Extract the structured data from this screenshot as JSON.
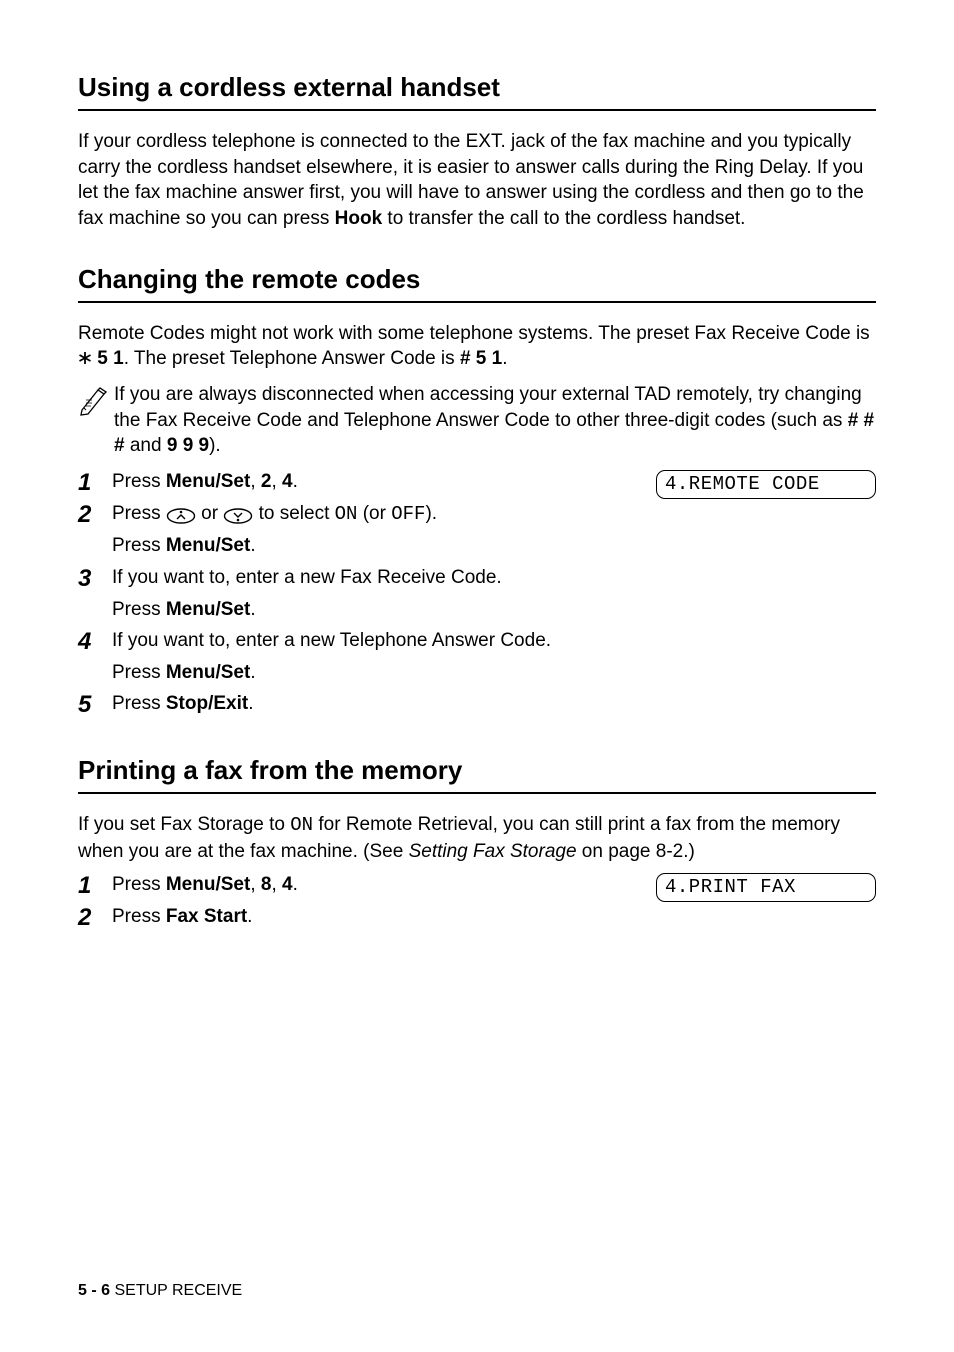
{
  "sections": {
    "sec1": {
      "heading": "Using a cordless external handset",
      "para_parts": {
        "a": "If your cordless telephone is connected to the EXT. jack of the fax machine and you typically carry the cordless handset elsewhere, it is easier to answer calls during the Ring Delay. If you let the fax machine answer first, you will have to answer using the cordless and then go to the fax machine so you can press ",
        "hook": "Hook",
        "b": " to transfer the call to the cordless handset."
      }
    },
    "sec2": {
      "heading": "Changing the remote codes",
      "para_parts": {
        "a": "Remote Codes might not work with some telephone systems. The preset Fax Receive Code is ",
        "code1": " 5 1",
        "b": ". The preset Telephone Answer Code is ",
        "code2": "# 5 1",
        "c": "."
      },
      "note": {
        "a": "If you are always disconnected when accessing your external TAD remotely, try changing the Fax Receive Code and Telephone Answer Code to other three-digit codes (such as ",
        "code1": "# # #",
        "b": " and ",
        "code2": "9 9 9",
        "c": ")."
      },
      "steps": {
        "s1": {
          "press": "Press ",
          "menuset": "Menu/Set",
          "comma1": ", ",
          "two": "2",
          "comma2": ", ",
          "four": "4",
          "dot": ".",
          "lcd": "4.REMOTE CODE"
        },
        "s2": {
          "a": "Press ",
          "b": " or ",
          "c": " to select ",
          "on": "ON",
          "d": " (or ",
          "off": "OFF",
          "e": ").",
          "press2": "Press ",
          "menuset2": "Menu/Set",
          "dot2": "."
        },
        "s3": {
          "a": "If you want to, enter a new Fax Receive Code.",
          "press": "Press ",
          "menuset": "Menu/Set",
          "dot": "."
        },
        "s4": {
          "a": "If you want to, enter a new Telephone Answer Code.",
          "press": "Press ",
          "menuset": "Menu/Set",
          "dot": "."
        },
        "s5": {
          "press": "Press ",
          "stopexit": "Stop/Exit",
          "dot": "."
        }
      }
    },
    "sec3": {
      "heading": "Printing a fax from the memory",
      "para_parts": {
        "a": "If you set Fax Storage to ",
        "on": "ON",
        "b": " for Remote Retrieval, you can still print a fax from the memory when you are at the fax machine. (See ",
        "link": "Setting Fax Storage",
        "c": " on page 8-2.)"
      },
      "steps": {
        "s1": {
          "press": "Press ",
          "menuset": "Menu/Set",
          "comma1": ", ",
          "eight": "8",
          "comma2": ", ",
          "four": "4",
          "dot": ".",
          "lcd": "4.PRINT FAX"
        },
        "s2": {
          "press": "Press ",
          "faxstart": "Fax Start",
          "dot": "."
        }
      }
    }
  },
  "footer": {
    "page": "5 - 6",
    "sep": "   ",
    "title": "SETUP RECEIVE"
  }
}
